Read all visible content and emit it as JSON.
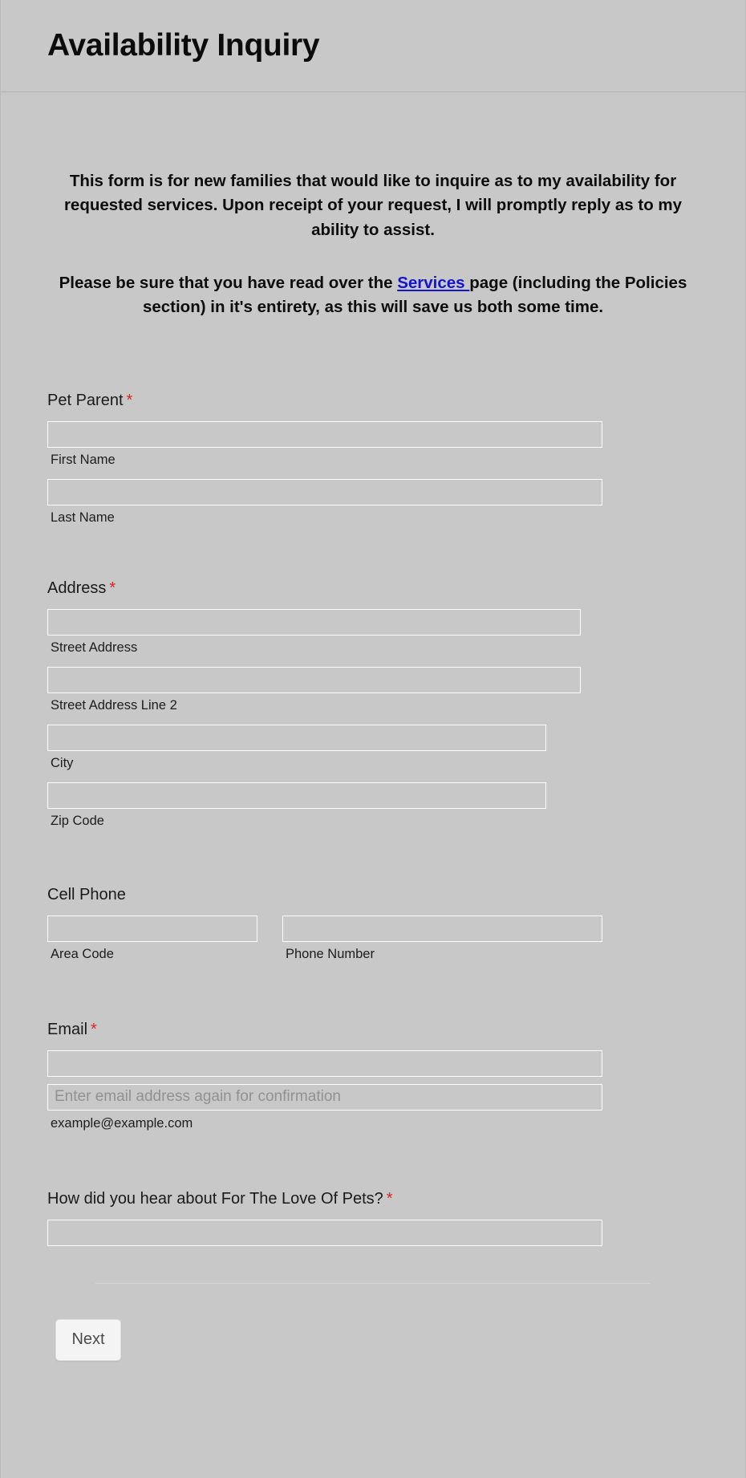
{
  "header": {
    "title": "Availability Inquiry"
  },
  "intro": {
    "paragraph1": "This form is for new families that would like to inquire as to my availability for requested services.  Upon receipt of your request, I will promptly reply as to my ability to assist.",
    "paragraph2_before": "Please be sure that you have read over the ",
    "paragraph2_link": "Services ",
    "paragraph2_after": "page (including the Policies section) in it's entirety, as this will save us both some time.",
    "link_color": "#1414d0"
  },
  "required_marker": "*",
  "fields": {
    "pet_parent": {
      "label": "Pet Parent",
      "required": true,
      "first_name": {
        "value": "",
        "placeholder": "",
        "sublabel": "First Name"
      },
      "last_name": {
        "value": "",
        "placeholder": "",
        "sublabel": "Last Name"
      }
    },
    "address": {
      "label": "Address",
      "required": true,
      "street": {
        "value": "",
        "placeholder": "",
        "sublabel": "Street Address"
      },
      "street2": {
        "value": "",
        "placeholder": "",
        "sublabel": "Street Address Line 2"
      },
      "city": {
        "value": "",
        "placeholder": "",
        "sublabel": "City"
      },
      "zip": {
        "value": "",
        "placeholder": "",
        "sublabel": "Zip Code"
      }
    },
    "cell_phone": {
      "label": "Cell Phone",
      "required": false,
      "area_code": {
        "value": "",
        "placeholder": "",
        "sublabel": "Area Code"
      },
      "phone_number": {
        "value": "",
        "placeholder": "",
        "sublabel": "Phone Number"
      }
    },
    "email": {
      "label": "Email",
      "required": true,
      "address": {
        "value": "",
        "placeholder": ""
      },
      "confirm": {
        "value": "",
        "placeholder": "Enter email address again for confirmation"
      },
      "help": "example@example.com"
    },
    "referral": {
      "label": "How did you hear about For The Love Of Pets?",
      "required": true,
      "input": {
        "value": "",
        "placeholder": ""
      }
    }
  },
  "footer": {
    "next_label": "Next"
  },
  "colors": {
    "page_background": "#c8c8c8",
    "input_border": "#ffffff",
    "required_asterisk": "#e32020",
    "button_background": "#f4f4f4",
    "divider": "#d6d6d6"
  }
}
